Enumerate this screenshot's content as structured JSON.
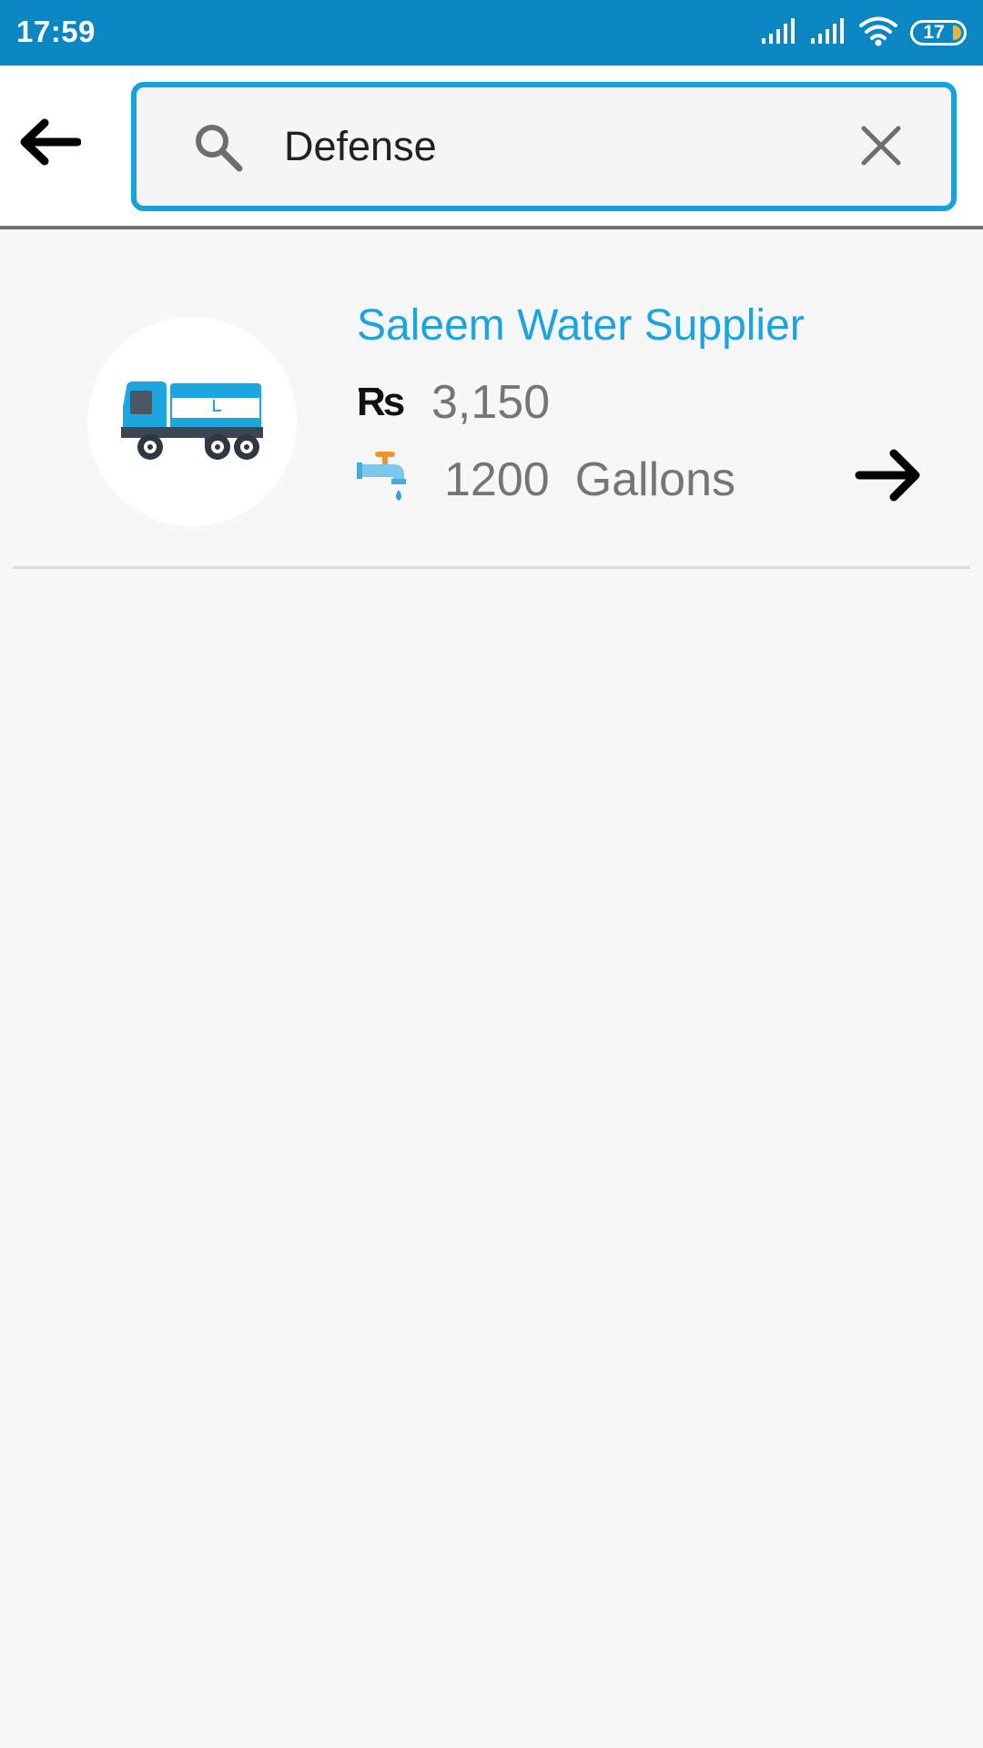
{
  "status_bar": {
    "time": "17:59",
    "battery_level": "17",
    "icons": [
      "signal-icon",
      "signal-icon",
      "wifi-icon",
      "battery-icon"
    ]
  },
  "search": {
    "value": "Defense",
    "placeholder": "",
    "icons": [
      "back-arrow-icon",
      "search-icon",
      "close-icon"
    ]
  },
  "results": [
    {
      "name": "Saleem Water Supplier",
      "currency_symbol": "Rs",
      "price": "3,150",
      "volume": "1200",
      "unit": "Gallons",
      "icons": [
        "water-truck-icon",
        "rupee-icon",
        "water-tap-icon",
        "forward-arrow-icon"
      ]
    }
  ],
  "colors": {
    "status_bar": "#0a87c2",
    "accent": "#1ba4df",
    "search_border": "#13a3df",
    "background": "#f7f7f7"
  }
}
